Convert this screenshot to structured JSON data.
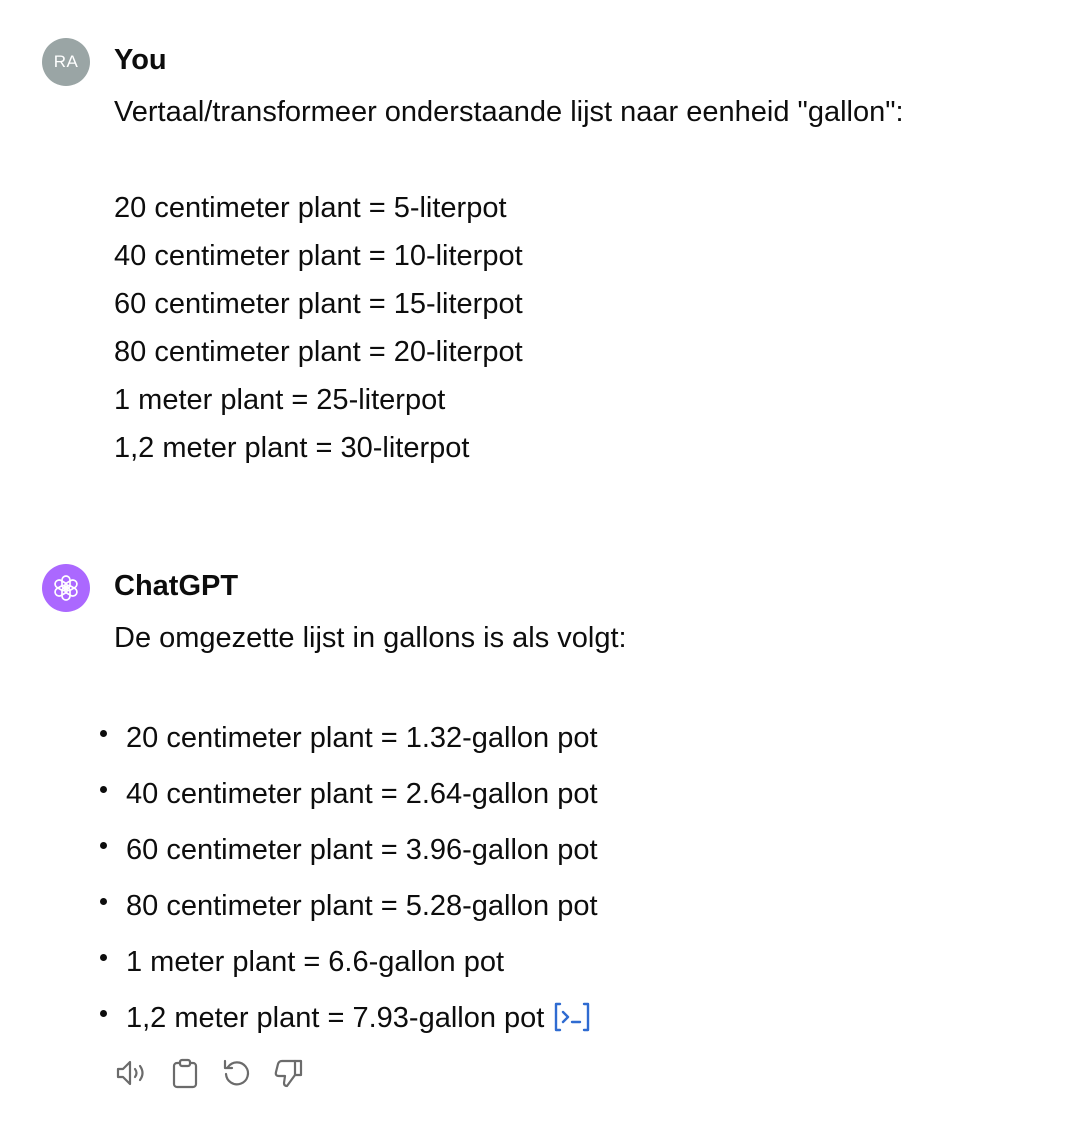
{
  "user_message": {
    "avatar_initials": "RA",
    "author": "You",
    "intro": "Vertaal/transformeer onderstaande lijst naar eenheid \"gallon\":",
    "lines": [
      "20 centimeter plant = 5-literpot",
      "40 centimeter plant = 10-literpot",
      "60 centimeter plant = 15-literpot",
      "80 centimeter plant = 20-literpot",
      "1 meter plant = 25-literpot",
      "1,2 meter plant = 30-literpot"
    ]
  },
  "assistant_message": {
    "avatar_icon": "openai-logo-icon",
    "author": "ChatGPT",
    "intro": "De omgezette lijst in gallons is als volgt:",
    "items": [
      "20 centimeter plant = 1.32-gallon pot",
      "40 centimeter plant = 2.64-gallon pot",
      "60 centimeter plant = 3.96-gallon pot",
      "80 centimeter plant = 5.28-gallon pot",
      "1 meter plant = 6.6-gallon pot",
      "1,2 meter plant = 7.93-gallon pot"
    ],
    "actions": [
      "read-aloud-icon",
      "copy-icon",
      "regenerate-icon",
      "thumbs-down-icon"
    ]
  },
  "colors": {
    "user_avatar": "#9aa5a5",
    "assistant_avatar": "#ab68ff",
    "code_link": "#2f6bd1",
    "icon_gray": "#6b6b6b"
  }
}
